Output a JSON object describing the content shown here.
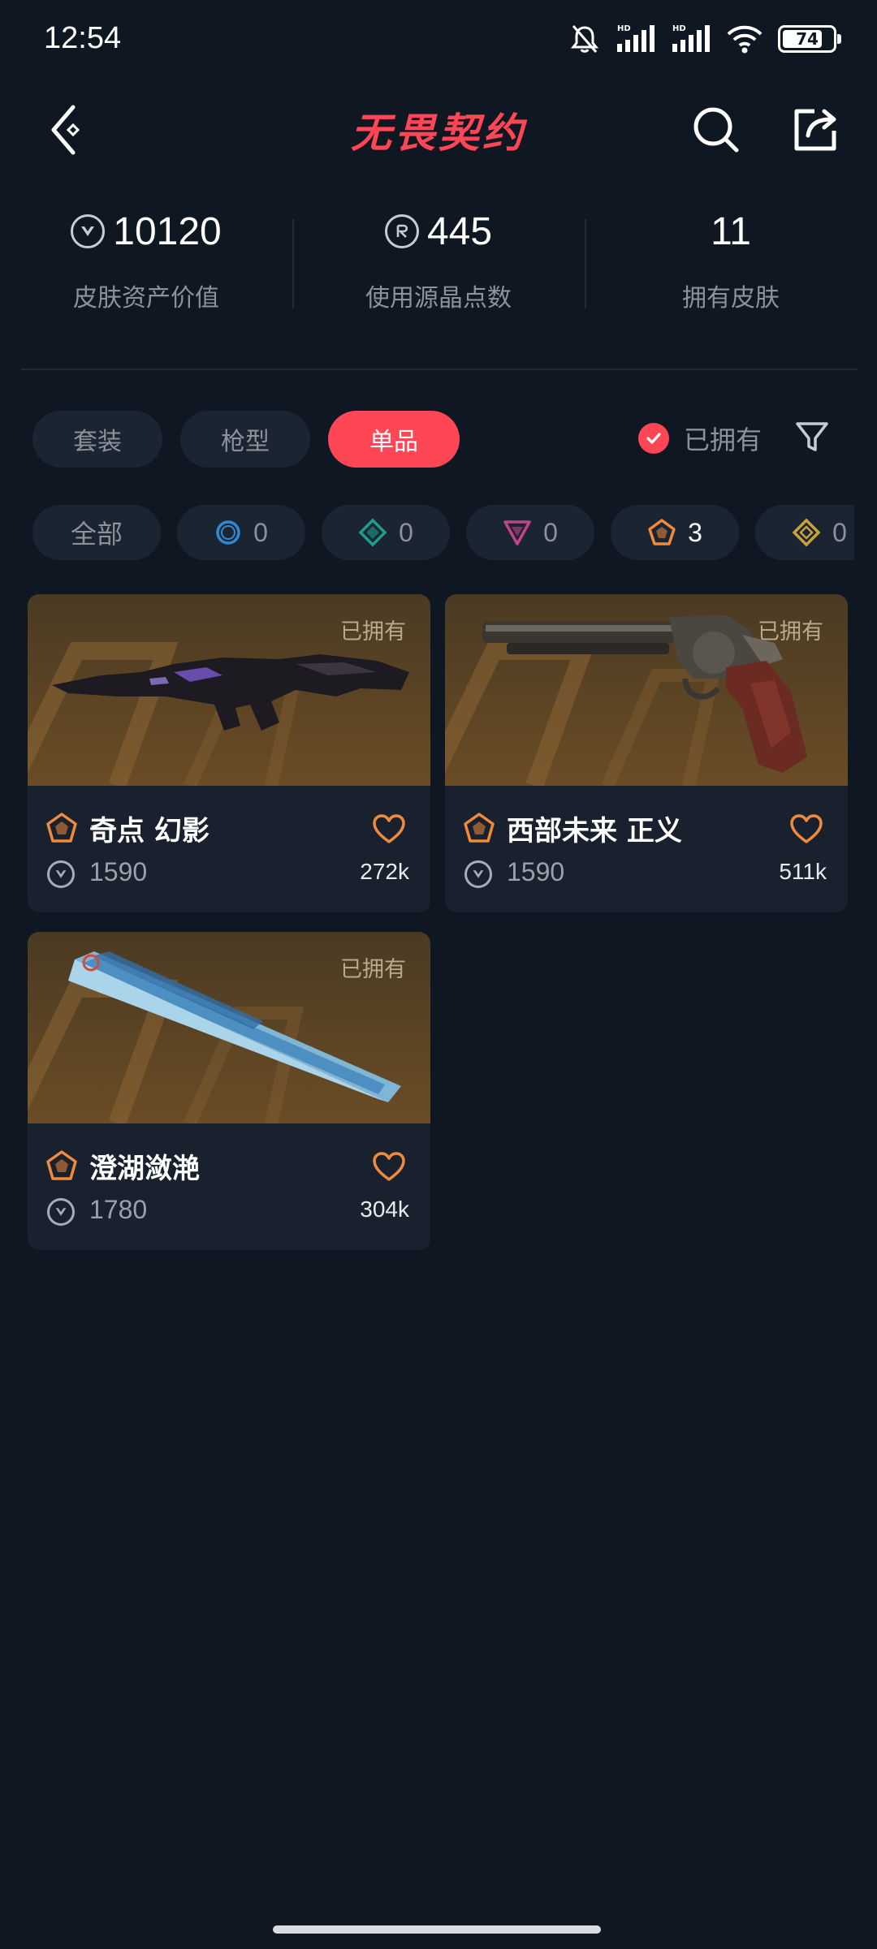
{
  "status_bar": {
    "time": "12:54",
    "battery": "74",
    "icons": [
      "mute-icon",
      "signal-hd-icon",
      "signal-hd-icon",
      "wifi-icon",
      "battery-icon"
    ]
  },
  "header": {
    "title": "无畏契约",
    "icons": [
      "back-icon",
      "search-icon",
      "share-icon"
    ],
    "accent": "#ff4655"
  },
  "stats": [
    {
      "icon": "vp-icon",
      "value": "10120",
      "label": "皮肤资产价值"
    },
    {
      "icon": "radianite-icon",
      "value": "445",
      "label": "使用源晶点数"
    },
    {
      "icon": "",
      "value": "11",
      "label": "拥有皮肤"
    }
  ],
  "tabs": [
    {
      "label": "套装",
      "active": false
    },
    {
      "label": "枪型",
      "active": false
    },
    {
      "label": "单品",
      "active": true
    }
  ],
  "owned_filter": {
    "label": "已拥有",
    "checked": true
  },
  "rarity_chips": [
    {
      "label": "全部",
      "count": ""
    },
    {
      "icon": "select-tier-icon",
      "color": "#2e8ad6",
      "count": "0"
    },
    {
      "icon": "deluxe-tier-icon",
      "color": "#1e9e8a",
      "count": "0"
    },
    {
      "icon": "premium-tier-icon",
      "color": "#c0448a",
      "count": "0"
    },
    {
      "icon": "exclusive-tier-icon",
      "color": "#f08a3c",
      "count": "3",
      "active": true
    },
    {
      "icon": "ultra-tier-icon",
      "color": "#c9a23c",
      "count": "0"
    }
  ],
  "items": [
    {
      "name": "奇点 幻影",
      "price": "1590",
      "likes": "272k",
      "owned_label": "已拥有"
    },
    {
      "name": "西部未来 正义",
      "price": "1590",
      "likes": "511k",
      "owned_label": "已拥有"
    },
    {
      "name": "澄湖潋滟",
      "price": "1780",
      "likes": "304k",
      "owned_label": "已拥有"
    }
  ],
  "colors": {
    "background": "#0f1722",
    "card": "#18212d",
    "chip": "#1b2431",
    "tier_orange": "#f08a3c"
  }
}
